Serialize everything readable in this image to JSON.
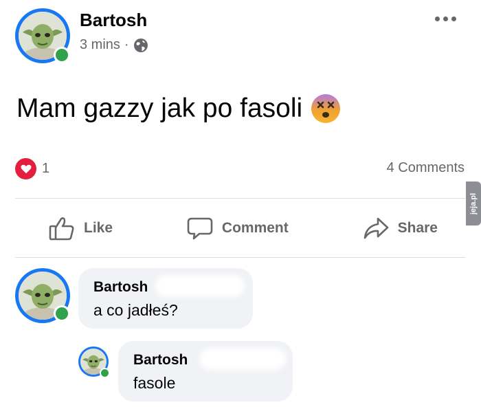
{
  "post": {
    "author": "Bartosh",
    "time": "3 mins",
    "separator": "·",
    "text": "Mam gazzy jak po fasoli",
    "emoji": "😵",
    "reaction_count": "1",
    "comments_count": "4 Comments"
  },
  "actions": {
    "like": "Like",
    "comment": "Comment",
    "share": "Share"
  },
  "comments": [
    {
      "author": "Bartosh",
      "text": "a co jadłeś?"
    },
    {
      "author": "Bartosh",
      "text": "fasole"
    }
  ],
  "colors": {
    "brand_blue": "#1877f2",
    "online_green": "#31a24c",
    "love_red": "#e41e3f",
    "secondary_text": "#65676b",
    "bubble_bg": "#f0f2f5"
  },
  "icons": [
    "globe-icon",
    "more-dots-icon",
    "love-reaction-icon",
    "like-thumb-icon",
    "comment-icon",
    "share-arrow-icon"
  ]
}
